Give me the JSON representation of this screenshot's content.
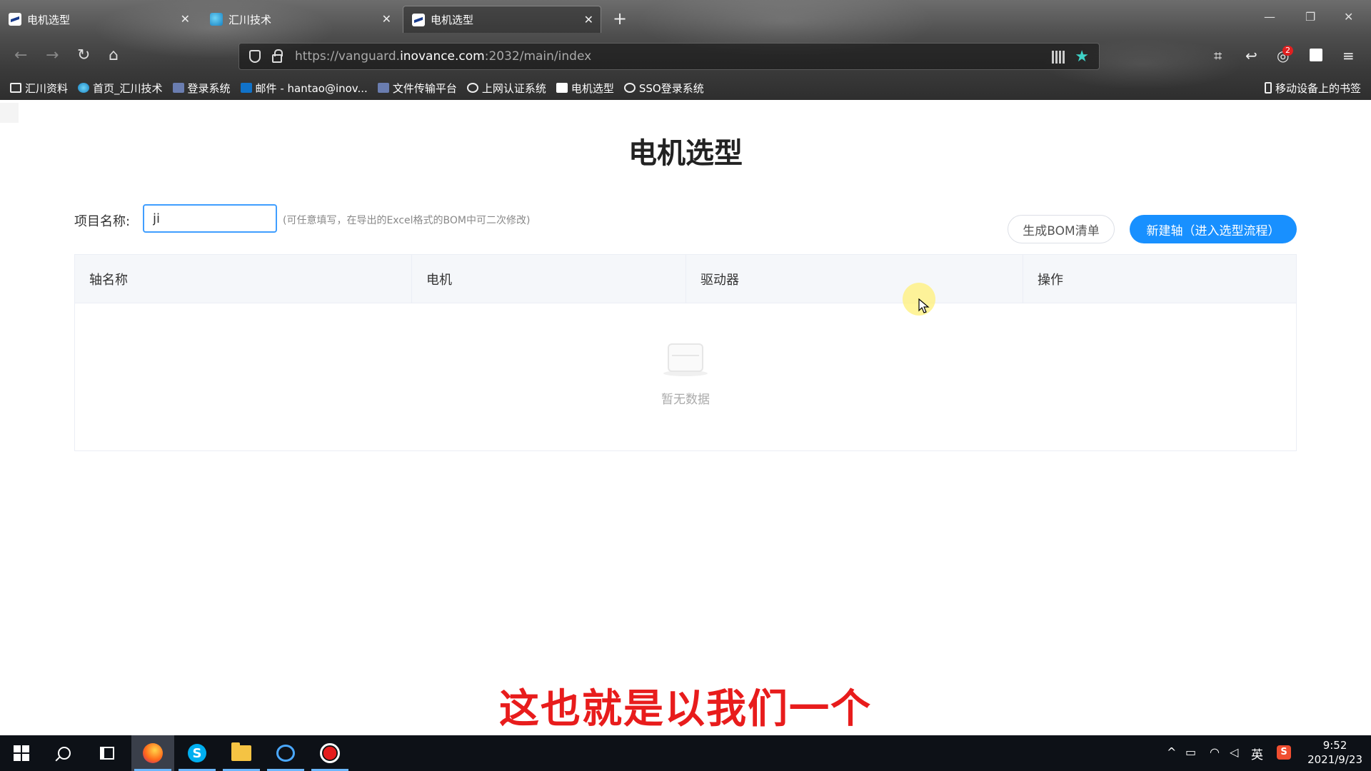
{
  "browser": {
    "tabs": [
      {
        "title": "电机选型",
        "active": false,
        "icon": "inovance-icon"
      },
      {
        "title": "汇川技术",
        "active": false,
        "icon": "globe-icon"
      },
      {
        "title": "电机选型",
        "active": true,
        "icon": "inovance-icon"
      }
    ],
    "url_prefix": "https://vanguard.",
    "url_domain": "inovance.com",
    "url_suffix": ":2032/main/index",
    "notification_badge": "2",
    "bookmarks": [
      {
        "label": "汇川资料",
        "icon": "folder-icon"
      },
      {
        "label": "首页_汇川技术",
        "icon": "globe-icon"
      },
      {
        "label": "登录系统",
        "icon": "inovance-icon"
      },
      {
        "label": "邮件 - hantao@inov...",
        "icon": "outlook-icon"
      },
      {
        "label": "文件传输平台",
        "icon": "inovance-icon"
      },
      {
        "label": "上网认证系统",
        "icon": "globe-outline-icon"
      },
      {
        "label": "电机选型",
        "icon": "inovance-icon"
      },
      {
        "label": "SSO登录系统",
        "icon": "globe-outline-icon"
      }
    ],
    "mobile_bookmarks": "移动设备上的书签"
  },
  "page": {
    "title": "电机选型",
    "project_label": "项目名称:",
    "project_value": "ji",
    "project_hint": "(可任意填写，在导出的Excel格式的BOM中可二次修改)",
    "bom_button": "生成BOM清单",
    "new_axis_button": "新建轴（进入选型流程）",
    "table": {
      "columns": [
        "轴名称",
        "电机",
        "驱动器",
        "操作"
      ],
      "rows": [],
      "empty_text": "暂无数据"
    }
  },
  "subtitle": "这也就是以我们一个",
  "taskbar": {
    "apps": [
      "windows-start-icon",
      "search-icon",
      "task-view-icon",
      "firefox-icon",
      "skype-icon",
      "file-explorer-icon",
      "chat-icon",
      "record-icon"
    ],
    "ime": "英",
    "time": "9:52",
    "date": "2021/9/23"
  },
  "colors": {
    "primary": "#1890ff",
    "subtitle": "#e81c1c",
    "focus_border": "#409eff"
  }
}
